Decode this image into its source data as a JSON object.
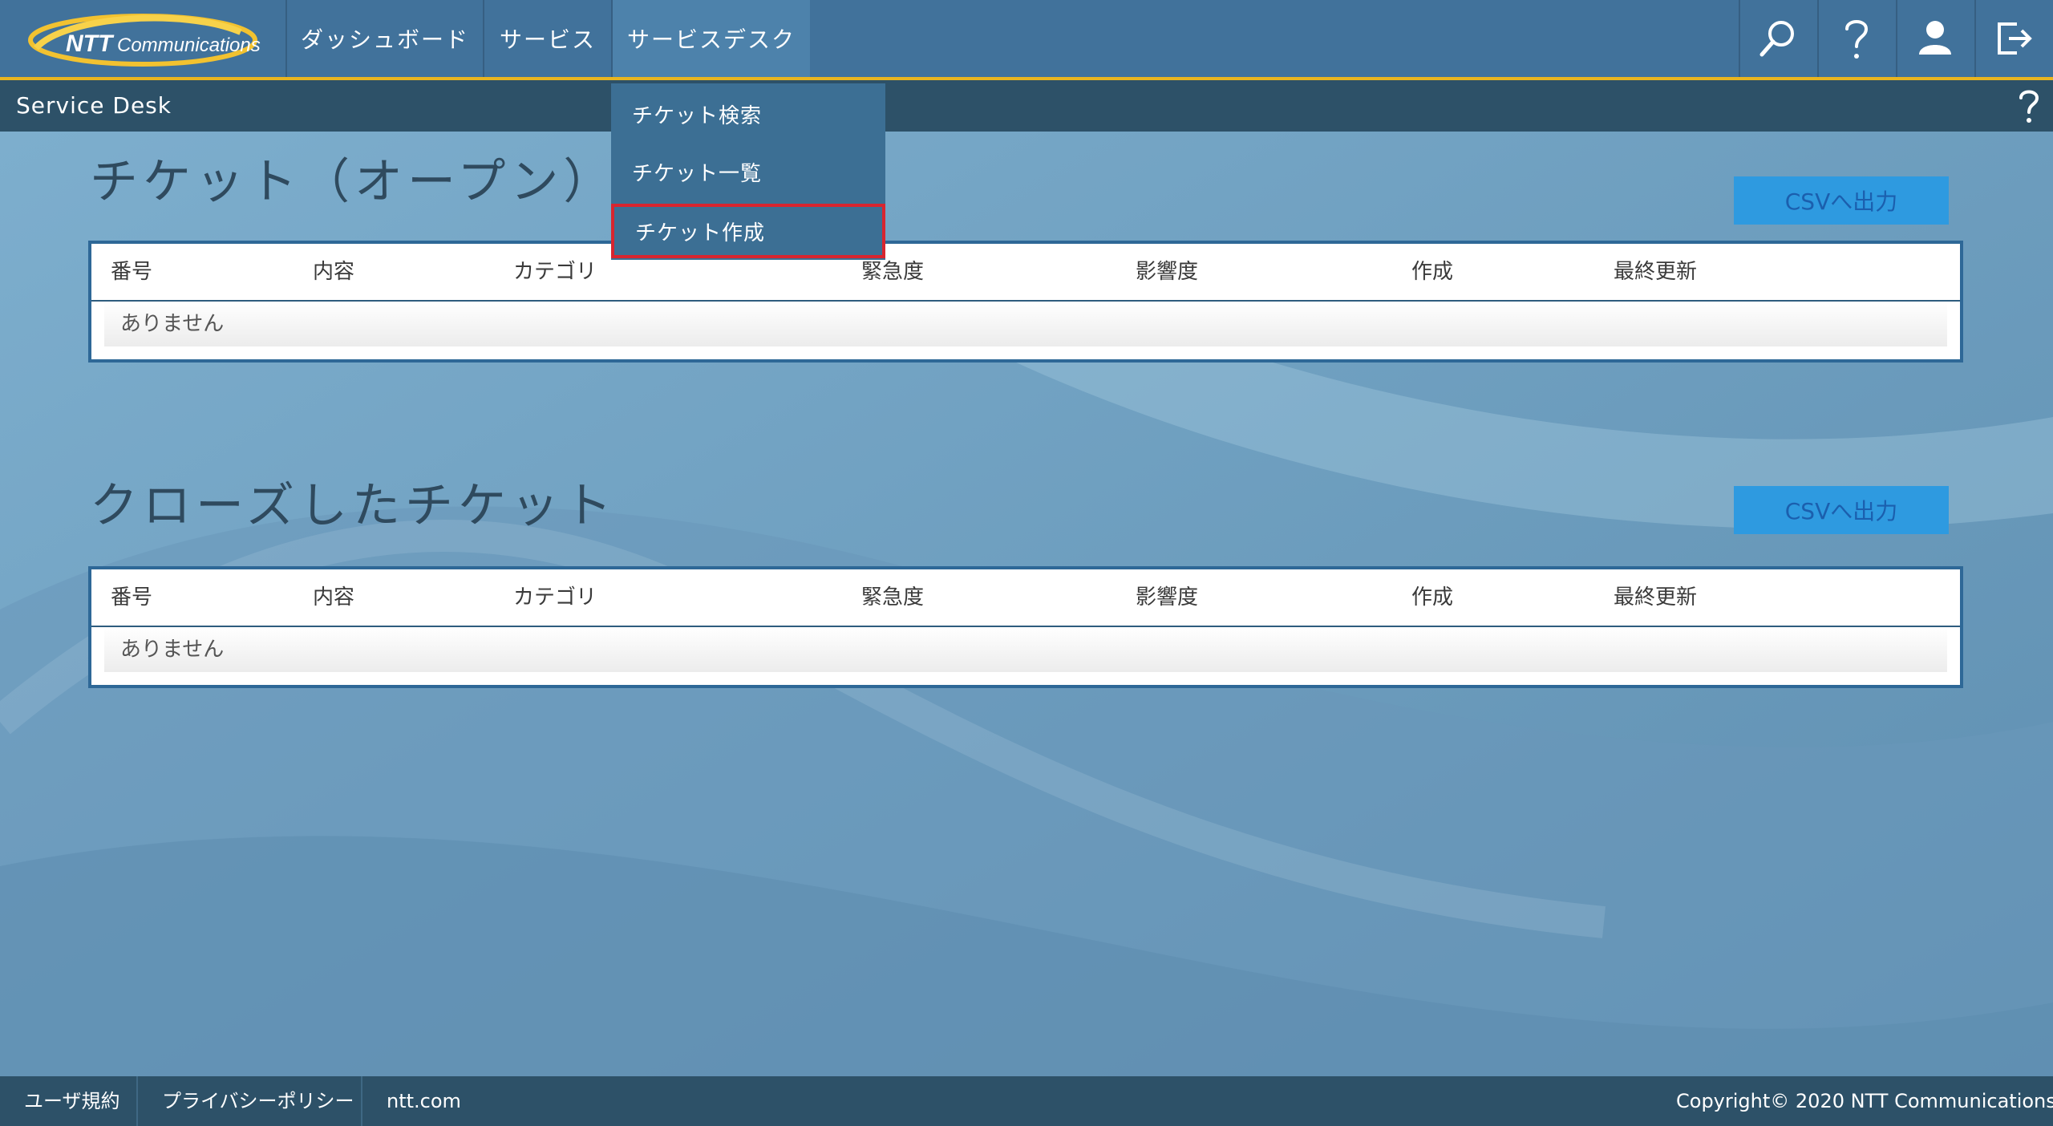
{
  "brand": {
    "logo_text": "NTT Communications",
    "logo_text_part1": "NTT",
    "logo_text_part2": "Communications"
  },
  "nav": {
    "items": [
      {
        "label": "ダッシュボード"
      },
      {
        "label": "サービス"
      },
      {
        "label": "サービスデスク"
      }
    ],
    "icons": [
      "search-icon",
      "help-icon",
      "user-icon",
      "logout-icon"
    ]
  },
  "subheader": {
    "title": "Service Desk",
    "help": "?"
  },
  "dropdown": {
    "items": [
      {
        "label": "チケット検索"
      },
      {
        "label": "チケット一覧"
      },
      {
        "label": "チケット作成"
      }
    ],
    "highlight_color": "#d8252f"
  },
  "open_section": {
    "title": "チケット（オープン）",
    "csv_label": "CSVへ出力",
    "columns": [
      "番号",
      "内容",
      "カテゴリ",
      "緊急度",
      "影響度",
      "作成",
      "最終更新"
    ],
    "empty_text": "ありません"
  },
  "closed_section": {
    "title": "クローズしたチケット",
    "csv_label": "CSVへ出力",
    "columns": [
      "番号",
      "内容",
      "カテゴリ",
      "緊急度",
      "影響度",
      "作成",
      "最終更新"
    ],
    "empty_text": "ありません"
  },
  "footer": {
    "terms": "ユーザ規約",
    "privacy": "プライバシーポリシー",
    "site": "ntt.com",
    "copyright": "Copyright© 2020 NTT Communications"
  },
  "colors": {
    "topbar": "#41729b",
    "accent_gold": "#e9b51f",
    "subbar": "#2d5168",
    "csv_button": "#2e9ae0",
    "panel_border": "#2e6897"
  }
}
